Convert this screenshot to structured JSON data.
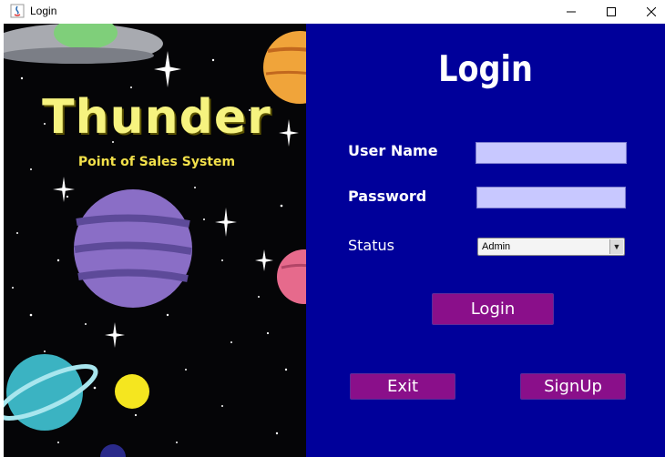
{
  "window": {
    "title": "Login"
  },
  "art": {
    "brand": "Thunder",
    "subtitle": "Point of Sales System"
  },
  "form": {
    "heading": "Login",
    "username_label": "User Name",
    "username_value": "",
    "password_label": "Password",
    "password_value": "",
    "status_label": "Status",
    "status_selected": "Admin"
  },
  "buttons": {
    "login": "Login",
    "exit": "Exit",
    "signup": "SignUp"
  },
  "colors": {
    "panel": "#00009a",
    "button": "#8a0f8a",
    "field": "#c8c8ff",
    "brand": "#f6f37f"
  }
}
